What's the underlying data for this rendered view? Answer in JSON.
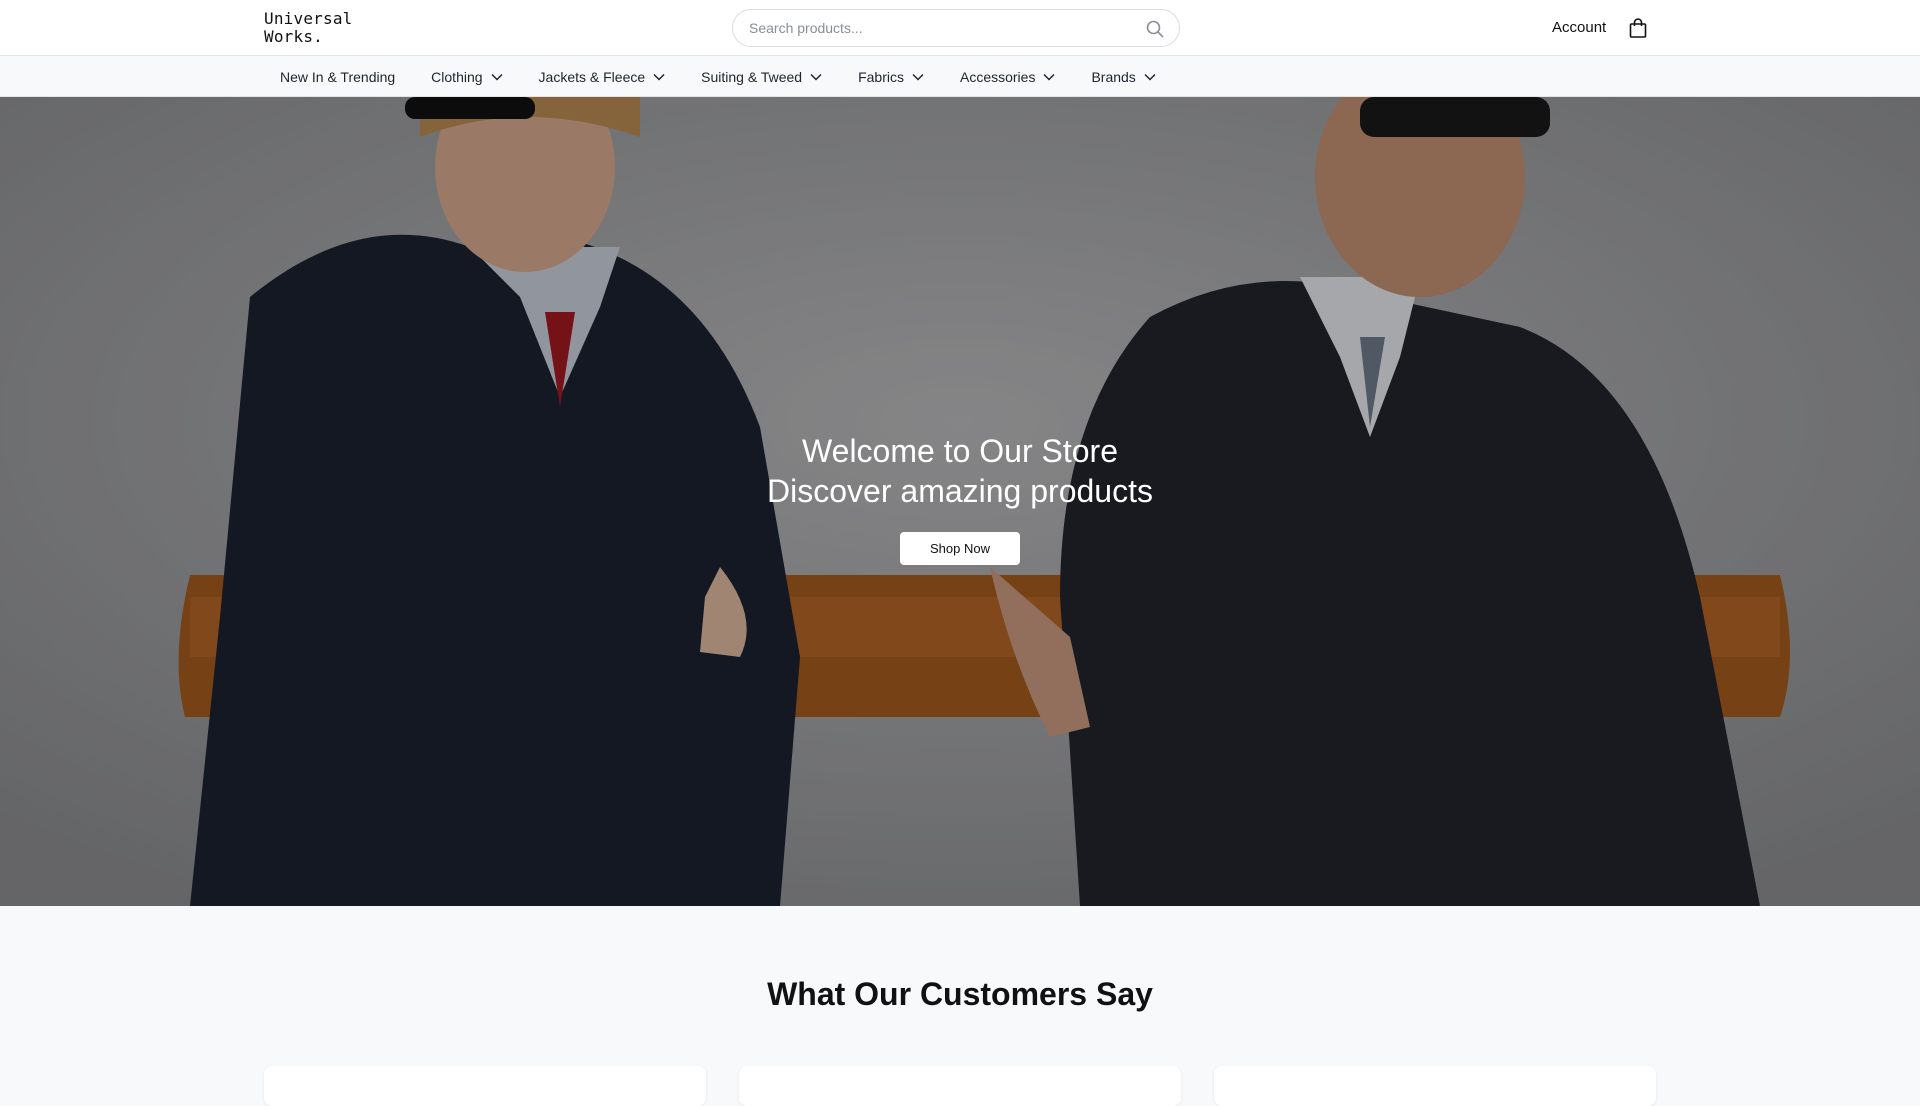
{
  "brand": {
    "logo_text": "Universal\nWorks."
  },
  "search": {
    "placeholder": "Search products..."
  },
  "header": {
    "account_label": "Account"
  },
  "nav": {
    "items": [
      {
        "label": "New In & Trending",
        "has_dropdown": false
      },
      {
        "label": "Clothing",
        "has_dropdown": true
      },
      {
        "label": "Jackets & Fleece",
        "has_dropdown": true
      },
      {
        "label": "Suiting & Tweed",
        "has_dropdown": true
      },
      {
        "label": "Fabrics",
        "has_dropdown": true
      },
      {
        "label": "Accessories",
        "has_dropdown": true
      },
      {
        "label": "Brands",
        "has_dropdown": true
      }
    ]
  },
  "hero": {
    "title_line1": "Welcome to Our Store",
    "title_line2": "Discover amazing products",
    "cta_label": "Shop Now"
  },
  "testimonials": {
    "title": "What Our Customers Say"
  },
  "colors": {
    "background": "#f8f9fb",
    "header_bg": "#ffffff",
    "text": "#111111",
    "button_bg": "#ffffff"
  },
  "icons": [
    "search-icon",
    "shopping-bag-icon",
    "chevron-down-icon"
  ]
}
